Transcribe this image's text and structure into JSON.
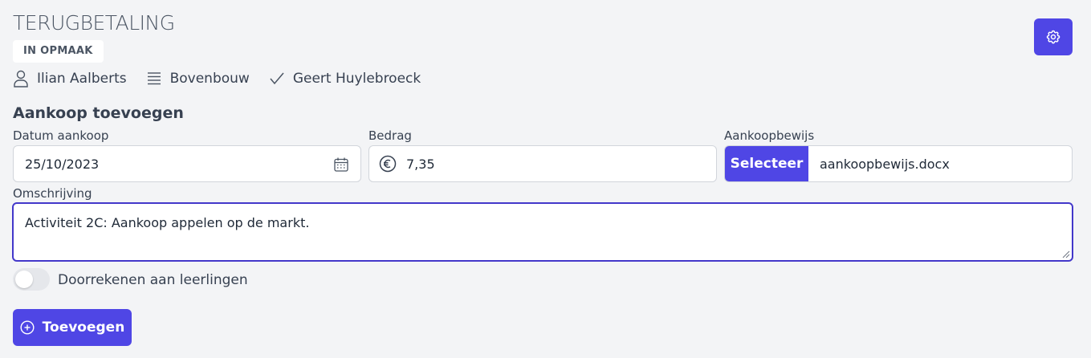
{
  "page": {
    "title": "TERUGBETALING",
    "status": "IN OPMAAK"
  },
  "meta": {
    "user": "Ilian Aalberts",
    "group": "Bovenbouw",
    "approver": "Geert Huylebroeck"
  },
  "form": {
    "section_title": "Aankoop toevoegen",
    "date_label": "Datum aankoop",
    "date_value": "25/10/2023",
    "amount_label": "Bedrag",
    "amount_value": "7,35",
    "receipt_label": "Aankoopbewijs",
    "select_label": "Selecteer",
    "file_name": "aankoopbewijs.docx",
    "description_label": "Omschrijving",
    "description_value": "Activiteit 2C: Aankoop appelen op de markt.",
    "toggle_label": "Doorrekenen aan leerlingen",
    "toggle_on": false,
    "add_label": "Toevoegen"
  },
  "icons": {
    "settings": "gear-icon",
    "user": "user-icon",
    "group": "list-icon",
    "approver": "check-icon",
    "calendar": "calendar-icon",
    "currency": "euro-icon",
    "add": "plus-circle-icon"
  },
  "colors": {
    "accent": "#4f46e5",
    "focus_border": "#4338ca",
    "background": "#f3f4f6"
  }
}
